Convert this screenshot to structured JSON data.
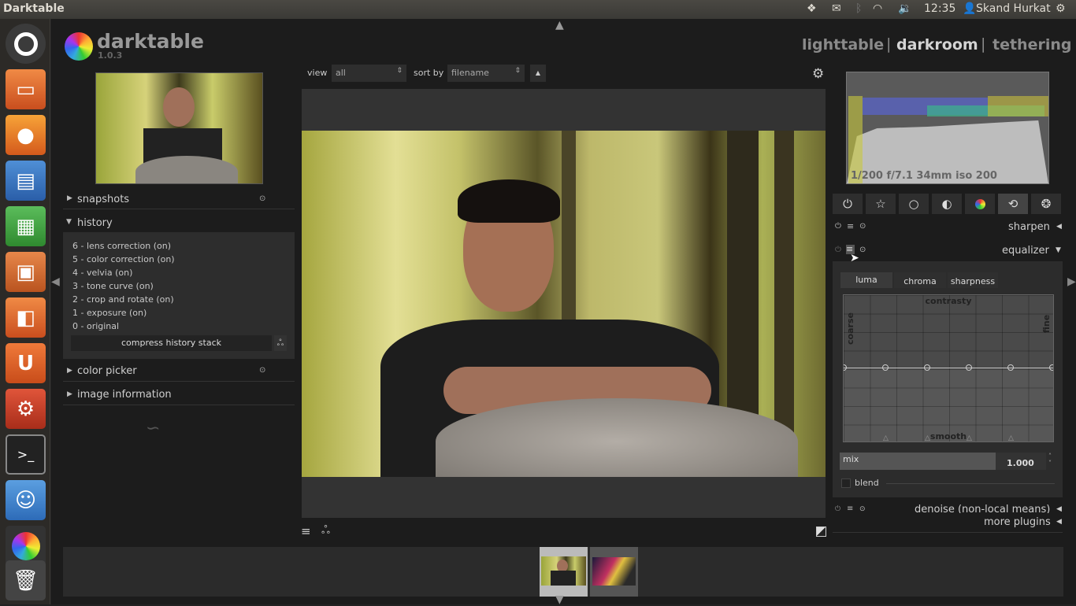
{
  "top_panel": {
    "app_title": "Darktable",
    "time": "12:35",
    "user": "Skand Hurkat"
  },
  "brand": {
    "name": "darktable",
    "version": "1.0.3"
  },
  "views": {
    "lighttable": "lighttable",
    "sep1": "|",
    "darkroom": "darkroom",
    "sep2": "|",
    "tethering": "tethering"
  },
  "top_controls": {
    "view_label": "view",
    "view_value": "all",
    "sort_label": "sort by",
    "sort_value": "filename",
    "sort_dir": "▲"
  },
  "left_panel": {
    "snapshots": "snapshots",
    "history": "history",
    "history_items": [
      "6 - lens correction (on)",
      "5 - color correction (on)",
      "4 - velvia (on)",
      "3 - tone curve (on)",
      "2 - crop and rotate (on)",
      "1 - exposure (on)",
      "0 - original"
    ],
    "compress": "compress history stack",
    "color_picker": "color picker",
    "image_information": "image information"
  },
  "histogram": {
    "exif": "1/200 f/7.1 34mm iso 200"
  },
  "modules": {
    "sharpen": "sharpen",
    "equalizer": "equalizer",
    "tabs": [
      "luma",
      "chroma",
      "sharpness"
    ],
    "graph_top": "contrasty",
    "graph_bottom": "smooth",
    "graph_left": "coarse",
    "graph_right": "fine",
    "mix_label": "mix",
    "mix_value": "1.000",
    "blend_label": "blend",
    "denoise": "denoise (non-local means)",
    "more_plugins": "more plugins"
  },
  "colors": {
    "accent": "#d4d4d4",
    "panel": "#2b2b2b",
    "bg": "#1c1c1c"
  }
}
